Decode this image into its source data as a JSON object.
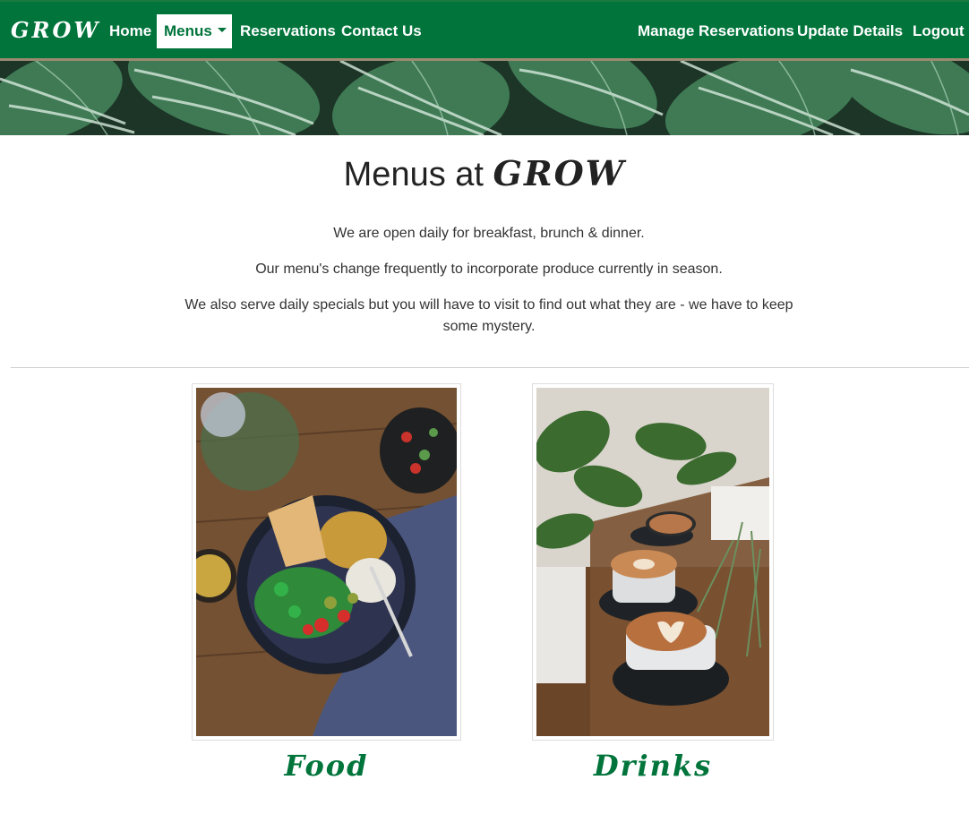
{
  "navbar": {
    "brand": "GROW",
    "links": {
      "home": "Home",
      "menus": "Menus",
      "reservations": "Reservations",
      "contact": "Contact Us",
      "manage_reservations": "Manage Reservations",
      "update_details": "Update Details",
      "logout": "Logout"
    },
    "active": "Menus"
  },
  "main": {
    "title_prefix": "Menus at",
    "title_brand": "GROW",
    "paragraphs": [
      "We are open daily for breakfast, brunch & dinner.",
      "Our menu's change frequently to incorporate produce currently in season.",
      "We also serve daily specials but you will have to visit to find out what they are - we have to keep some mystery."
    ]
  },
  "menus": [
    {
      "label": "Food",
      "image": "food-bowl-image"
    },
    {
      "label": "Drinks",
      "image": "coffee-cups-image"
    }
  ],
  "colors": {
    "brand_green": "#00743b",
    "nav_bottom_border": "#9b8a70",
    "text": "#333333"
  }
}
